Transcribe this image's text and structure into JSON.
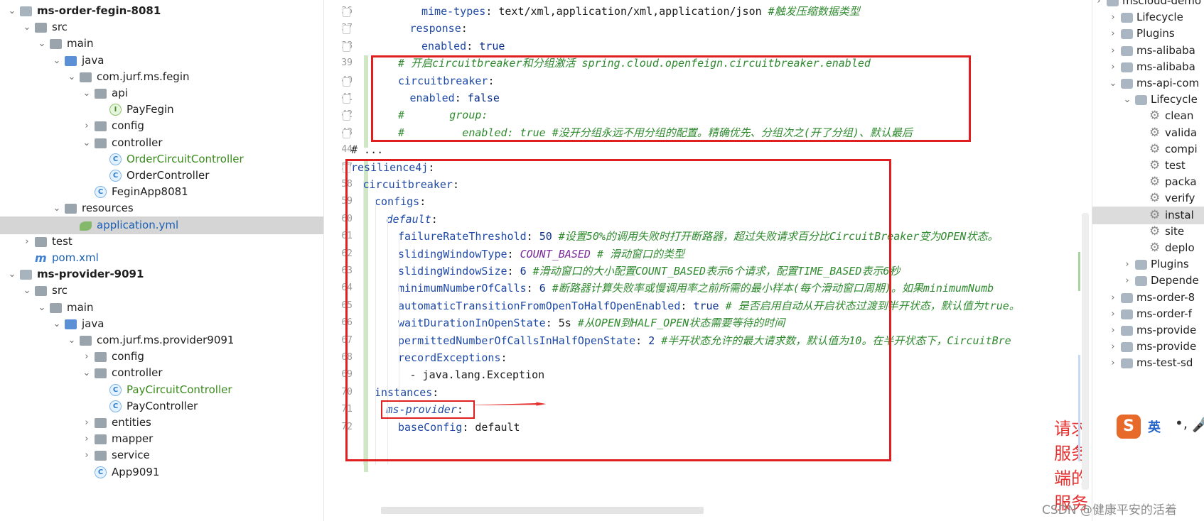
{
  "project_tree": [
    {
      "indent": 0,
      "arrow": "down",
      "icon": "module",
      "label": "ms-order-fegin-8081",
      "bold": true
    },
    {
      "indent": 1,
      "arrow": "down",
      "icon": "folder",
      "label": "src"
    },
    {
      "indent": 2,
      "arrow": "down",
      "icon": "folder",
      "label": "main"
    },
    {
      "indent": 3,
      "arrow": "down",
      "icon": "folder-blue",
      "label": "java"
    },
    {
      "indent": 4,
      "arrow": "down",
      "icon": "folder",
      "label": "com.jurf.ms.fegin"
    },
    {
      "indent": 5,
      "arrow": "down",
      "icon": "folder",
      "label": "api"
    },
    {
      "indent": 6,
      "arrow": "",
      "icon": "interface",
      "label": "PayFegin"
    },
    {
      "indent": 5,
      "arrow": "right",
      "icon": "folder",
      "label": "config"
    },
    {
      "indent": 5,
      "arrow": "down",
      "icon": "folder",
      "label": "controller"
    },
    {
      "indent": 6,
      "arrow": "",
      "icon": "class",
      "label": "OrderCircuitController",
      "color": "green"
    },
    {
      "indent": 6,
      "arrow": "",
      "icon": "class",
      "label": "OrderController"
    },
    {
      "indent": 5,
      "arrow": "",
      "icon": "class",
      "label": "FeginApp8081"
    },
    {
      "indent": 3,
      "arrow": "down",
      "icon": "folder",
      "label": "resources"
    },
    {
      "indent": 4,
      "arrow": "",
      "icon": "yml",
      "label": "application.yml",
      "color": "blue",
      "selected": true
    },
    {
      "indent": 1,
      "arrow": "right",
      "icon": "folder",
      "label": "test"
    },
    {
      "indent": 1,
      "arrow": "",
      "icon": "maven",
      "label": "pom.xml",
      "color": "blue"
    },
    {
      "indent": 0,
      "arrow": "down",
      "icon": "module",
      "label": "ms-provider-9091",
      "bold": true
    },
    {
      "indent": 1,
      "arrow": "down",
      "icon": "folder",
      "label": "src"
    },
    {
      "indent": 2,
      "arrow": "down",
      "icon": "folder",
      "label": "main"
    },
    {
      "indent": 3,
      "arrow": "down",
      "icon": "folder-blue",
      "label": "java"
    },
    {
      "indent": 4,
      "arrow": "down",
      "icon": "folder",
      "label": "com.jurf.ms.provider9091"
    },
    {
      "indent": 5,
      "arrow": "right",
      "icon": "folder",
      "label": "config"
    },
    {
      "indent": 5,
      "arrow": "down",
      "icon": "folder",
      "label": "controller"
    },
    {
      "indent": 6,
      "arrow": "",
      "icon": "class",
      "label": "PayCircuitController",
      "color": "green"
    },
    {
      "indent": 6,
      "arrow": "",
      "icon": "class",
      "label": "PayController"
    },
    {
      "indent": 5,
      "arrow": "right",
      "icon": "folder",
      "label": "entities"
    },
    {
      "indent": 5,
      "arrow": "right",
      "icon": "folder",
      "label": "mapper"
    },
    {
      "indent": 5,
      "arrow": "right",
      "icon": "folder",
      "label": "service"
    },
    {
      "indent": 5,
      "arrow": "",
      "icon": "class",
      "label": "App9091"
    }
  ],
  "code_lines": [
    {
      "num": "36",
      "indent": 6,
      "parts": [
        [
          "k",
          "mime-types"
        ],
        [
          "plain",
          ": "
        ],
        [
          "plain",
          "text/xml,application/xml,application/json "
        ],
        [
          "c",
          "#触发压缩数据类型"
        ]
      ]
    },
    {
      "num": "37",
      "indent": 5,
      "parts": [
        [
          "k",
          "response"
        ],
        [
          "plain",
          ":"
        ]
      ]
    },
    {
      "num": "38",
      "indent": 6,
      "parts": [
        [
          "k",
          "enabled"
        ],
        [
          "plain",
          ": "
        ],
        [
          "v",
          "true"
        ]
      ]
    },
    {
      "num": "39",
      "indent": 4,
      "parts": [
        [
          "c",
          "# 开启circuitbreaker和分组激活 spring.cloud.openfeign.circuitbreaker.enabled"
        ]
      ]
    },
    {
      "num": "40",
      "indent": 4,
      "parts": [
        [
          "k",
          "circuitbreaker"
        ],
        [
          "plain",
          ":"
        ]
      ]
    },
    {
      "num": "41",
      "indent": 5,
      "parts": [
        [
          "k",
          "enabled"
        ],
        [
          "plain",
          ": "
        ],
        [
          "v",
          "false"
        ]
      ]
    },
    {
      "num": "42",
      "indent": 4,
      "parts": [
        [
          "c",
          "#       group:"
        ]
      ]
    },
    {
      "num": "43",
      "indent": 4,
      "parts": [
        [
          "c",
          "#         enabled: true #没开分组永远不用分组的配置。精确优先、分组次之(开了分组)、默认最后"
        ]
      ]
    },
    {
      "num": "44",
      "indent": 0,
      "parts": [
        [
          "plain",
          "# ..."
        ]
      ]
    },
    {
      "num": "57",
      "indent": 0,
      "parts": [
        [
          "k",
          "resilience4j"
        ],
        [
          "plain",
          ":"
        ]
      ]
    },
    {
      "num": "58",
      "indent": 1,
      "parts": [
        [
          "k",
          "circuitbreaker"
        ],
        [
          "plain",
          ":"
        ]
      ]
    },
    {
      "num": "59",
      "indent": 2,
      "parts": [
        [
          "k",
          "configs"
        ],
        [
          "plain",
          ":"
        ]
      ]
    },
    {
      "num": "60",
      "indent": 3,
      "parts": [
        [
          "kit",
          "default"
        ],
        [
          "plain",
          ":"
        ]
      ]
    },
    {
      "num": "61",
      "indent": 4,
      "parts": [
        [
          "k",
          "failureRateThreshold"
        ],
        [
          "plain",
          ": "
        ],
        [
          "v",
          "50 "
        ],
        [
          "c",
          "#设置50%的调用失败时打开断路器，超过失败请求百分比CircuitBreaker变为OPEN状态。"
        ]
      ]
    },
    {
      "num": "62",
      "indent": 4,
      "parts": [
        [
          "k",
          "slidingWindowType"
        ],
        [
          "plain",
          ": "
        ],
        [
          "e",
          "COUNT_BASED"
        ],
        [
          "c",
          " # 滑动窗口的类型"
        ]
      ]
    },
    {
      "num": "63",
      "indent": 4,
      "parts": [
        [
          "k",
          "slidingWindowSize"
        ],
        [
          "plain",
          ": "
        ],
        [
          "v",
          "6 "
        ],
        [
          "c",
          "#滑动窗口的大小配置COUNT_BASED表示6个请求，配置TIME_BASED表示6秒"
        ]
      ]
    },
    {
      "num": "64",
      "indent": 4,
      "parts": [
        [
          "k",
          "minimumNumberOfCalls"
        ],
        [
          "plain",
          ": "
        ],
        [
          "v",
          "6 "
        ],
        [
          "c",
          "#断路器计算失败率或慢调用率之前所需的最小样本(每个滑动窗口周期)。如果minimumNumb"
        ]
      ]
    },
    {
      "num": "65",
      "indent": 4,
      "parts": [
        [
          "k",
          "automaticTransitionFromOpenToHalfOpenEnabled"
        ],
        [
          "plain",
          ": "
        ],
        [
          "v",
          "true "
        ],
        [
          "c",
          "# 是否启用自动从开启状态过渡到半开状态，默认值为true。"
        ]
      ]
    },
    {
      "num": "66",
      "indent": 4,
      "parts": [
        [
          "k",
          "waitDurationInOpenState"
        ],
        [
          "plain",
          ": "
        ],
        [
          "plain",
          "5s "
        ],
        [
          "c",
          "#从OPEN到HALF_OPEN状态需要等待的时间"
        ]
      ]
    },
    {
      "num": "67",
      "indent": 4,
      "parts": [
        [
          "k",
          "permittedNumberOfCallsInHalfOpenState"
        ],
        [
          "plain",
          ": "
        ],
        [
          "v",
          "2 "
        ],
        [
          "c",
          "#半开状态允许的最大请求数，默认值为10。在半开状态下，CircuitBre"
        ]
      ]
    },
    {
      "num": "68",
      "indent": 4,
      "parts": [
        [
          "k",
          "recordExceptions"
        ],
        [
          "plain",
          ":"
        ]
      ]
    },
    {
      "num": "69",
      "indent": 5,
      "parts": [
        [
          "plain",
          "- java.lang.Exception"
        ]
      ]
    },
    {
      "num": "70",
      "indent": 2,
      "parts": [
        [
          "k",
          "instances"
        ],
        [
          "plain",
          ":"
        ]
      ]
    },
    {
      "num": "71",
      "indent": 3,
      "parts": [
        [
          "kit",
          "ms-provider"
        ],
        [
          "plain",
          ":"
        ]
      ]
    },
    {
      "num": "72",
      "indent": 4,
      "parts": [
        [
          "k",
          "baseConfig"
        ],
        [
          "plain",
          ": "
        ],
        [
          "plain",
          "default"
        ]
      ]
    }
  ],
  "annotation": {
    "text": "请求服务端的服务",
    "color": "#e53030"
  },
  "maven_tree": [
    {
      "indent": 0,
      "arrow": "right",
      "icon": "mvn",
      "label": "mscloud-demo"
    },
    {
      "indent": 1,
      "arrow": "right",
      "icon": "mvn",
      "label": "Lifecycle"
    },
    {
      "indent": 1,
      "arrow": "right",
      "icon": "mvn",
      "label": "Plugins"
    },
    {
      "indent": 1,
      "arrow": "right",
      "icon": "mvn",
      "label": "ms-alibaba"
    },
    {
      "indent": 1,
      "arrow": "right",
      "icon": "mvn",
      "label": "ms-alibaba"
    },
    {
      "indent": 1,
      "arrow": "down",
      "icon": "mvn",
      "label": "ms-api-com"
    },
    {
      "indent": 2,
      "arrow": "down",
      "icon": "mvn",
      "label": "Lifecycle"
    },
    {
      "indent": 3,
      "arrow": "",
      "icon": "gear",
      "label": "clean"
    },
    {
      "indent": 3,
      "arrow": "",
      "icon": "gear",
      "label": "valida"
    },
    {
      "indent": 3,
      "arrow": "",
      "icon": "gear",
      "label": "compi"
    },
    {
      "indent": 3,
      "arrow": "",
      "icon": "gear",
      "label": "test"
    },
    {
      "indent": 3,
      "arrow": "",
      "icon": "gear",
      "label": "packa"
    },
    {
      "indent": 3,
      "arrow": "",
      "icon": "gear",
      "label": "verify"
    },
    {
      "indent": 3,
      "arrow": "",
      "icon": "gear",
      "label": "instal",
      "selected": true
    },
    {
      "indent": 3,
      "arrow": "",
      "icon": "gear",
      "label": "site"
    },
    {
      "indent": 3,
      "arrow": "",
      "icon": "gear",
      "label": "deplo"
    },
    {
      "indent": 2,
      "arrow": "right",
      "icon": "mvn",
      "label": "Plugins"
    },
    {
      "indent": 2,
      "arrow": "right",
      "icon": "mvn",
      "label": "Depende"
    },
    {
      "indent": 1,
      "arrow": "right",
      "icon": "mvn",
      "label": "ms-order-8"
    },
    {
      "indent": 1,
      "arrow": "right",
      "icon": "mvn",
      "label": "ms-order-f"
    },
    {
      "indent": 1,
      "arrow": "right",
      "icon": "mvn",
      "label": "ms-provide"
    },
    {
      "indent": 1,
      "arrow": "right",
      "icon": "mvn",
      "label": "ms-provide"
    },
    {
      "indent": 1,
      "arrow": "right",
      "icon": "mvn",
      "label": "ms-test-sd"
    }
  ],
  "ime_bar": {
    "logo": "S",
    "mode": "英",
    "punct": "•,",
    "mic": "🎤"
  },
  "watermark": "CSDN @健康平安的活着"
}
